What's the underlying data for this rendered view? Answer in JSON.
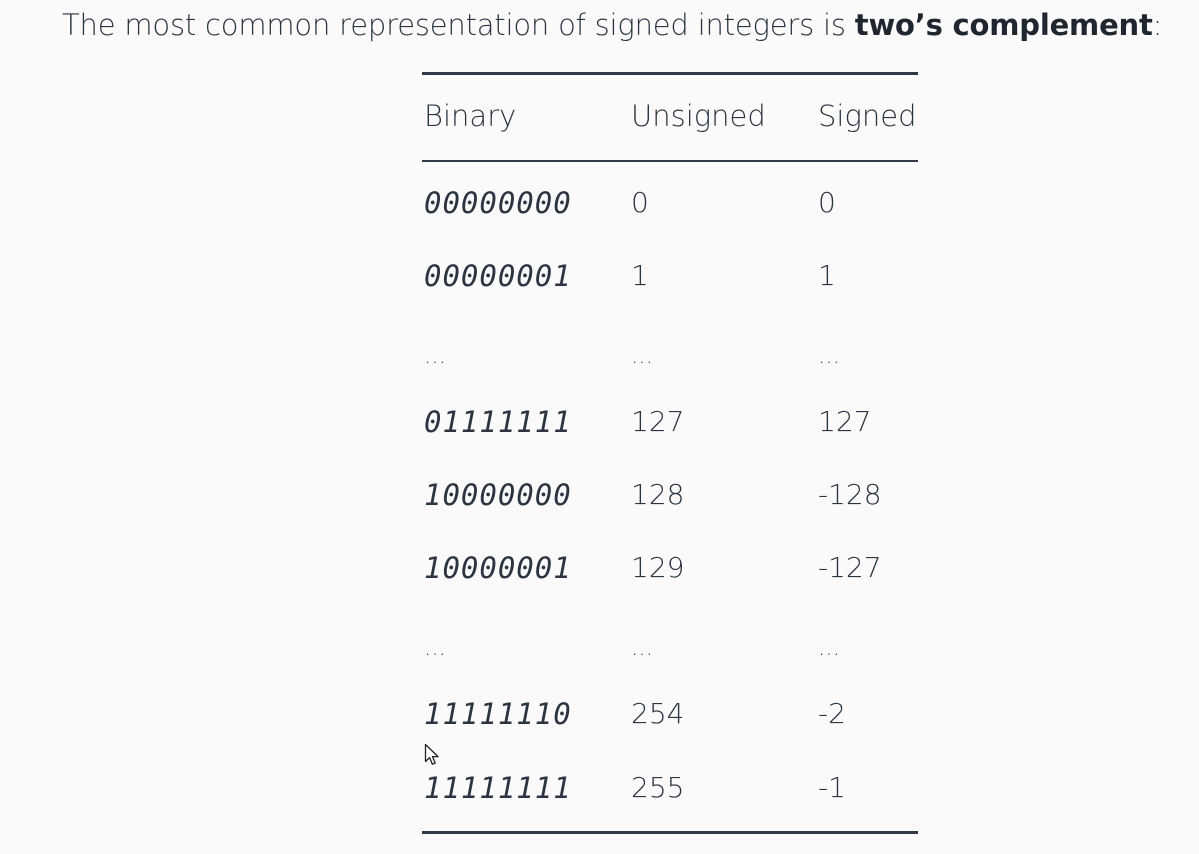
{
  "intro": {
    "text": "The most common representation of signed integers is ",
    "emphasis": "two’s complement",
    "suffix": ":"
  },
  "table": {
    "headers": [
      "Binary",
      "Unsigned",
      "Signed"
    ],
    "rows": [
      [
        "00000000",
        "0",
        "0"
      ],
      [
        "00000001",
        "1",
        "1"
      ],
      [
        "…",
        "…",
        "…"
      ],
      [
        "01111111",
        "127",
        "127"
      ],
      [
        "10000000",
        "128",
        "-128"
      ],
      [
        "10000001",
        "129",
        "-127"
      ],
      [
        "…",
        "…",
        "…"
      ],
      [
        "11111110",
        "254",
        "-2"
      ],
      [
        "11111111",
        "255",
        "-1"
      ]
    ]
  },
  "icons": {
    "cursor": "mouse-pointer-icon"
  }
}
